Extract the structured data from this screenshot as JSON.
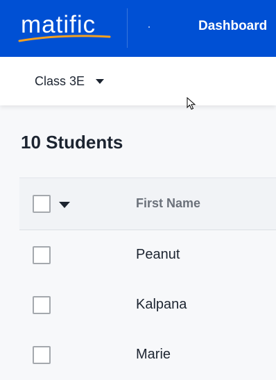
{
  "topbar": {
    "logo_text": "matific",
    "nav_dashboard": "Dashboard"
  },
  "class_selector": {
    "selected": "Class 3E"
  },
  "roster": {
    "heading": "10 Students",
    "columns": {
      "first_name": "First Name"
    },
    "students": [
      {
        "first_name": "Peanut"
      },
      {
        "first_name": "Kalpana"
      },
      {
        "first_name": "Marie"
      }
    ]
  },
  "colors": {
    "brand_blue": "#0050d4",
    "logo_swoosh": "#f5a020",
    "text_dark": "#1c2430",
    "header_muted": "#6b717a"
  }
}
